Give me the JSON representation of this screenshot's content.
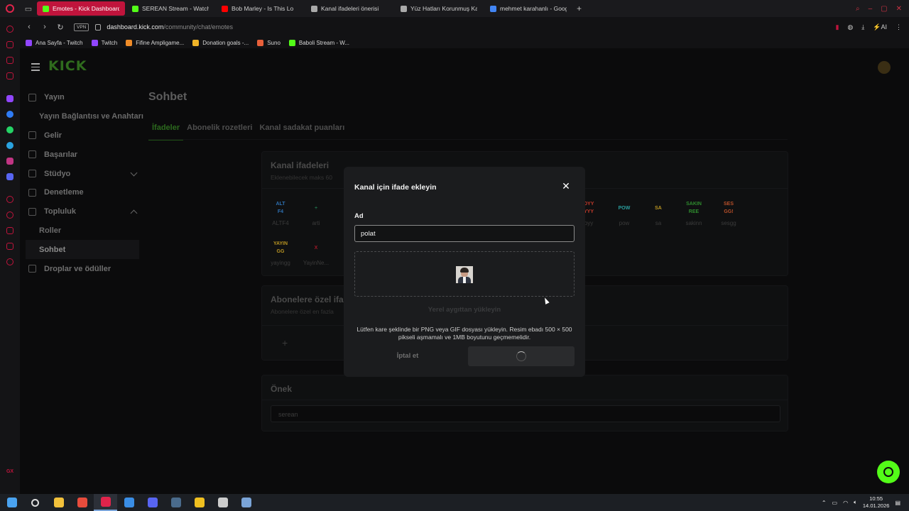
{
  "browser": {
    "tabs": [
      {
        "label": "Emotes - Kick Dashboard",
        "active": true,
        "color": "#53fc18"
      },
      {
        "label": "SEREAN Stream - Watch L",
        "active": false,
        "color": "#53fc18"
      },
      {
        "label": "Bob Marley - Is This Lo",
        "active": false,
        "color": "#ff0000"
      },
      {
        "label": "Kanal ifadeleri önerisi",
        "active": false,
        "color": "#aaaaaa"
      },
      {
        "label": "Yüz Hatları Korunmuş Kar",
        "active": false,
        "color": "#aaaaaa"
      },
      {
        "label": "mehmet karahanlı - Googl",
        "active": false,
        "color": "#4285f4"
      }
    ],
    "url_domain": "dashboard.kick.com",
    "url_path": "/community/chat/emotes",
    "vpn_label": "VPN",
    "ai_label": "AI",
    "bookmarks": [
      {
        "label": "Ana Sayfa - Twitch",
        "color": "#9146ff"
      },
      {
        "label": "Twitch",
        "color": "#9146ff"
      },
      {
        "label": "Fifine Ampligame...",
        "color": "#f08c28"
      },
      {
        "label": "Donation goals -...",
        "color": "#f0b428"
      },
      {
        "label": "Suno",
        "color": "#e8603a"
      },
      {
        "label": "Baboli Stream - W...",
        "color": "#53fc18"
      }
    ]
  },
  "app": {
    "logo": "KICK",
    "nav": [
      {
        "label": "Yayın",
        "type": "item",
        "name": "nav-yayin"
      },
      {
        "label": "Yayın Bağlantısı ve Anahtarı",
        "type": "sub",
        "name": "nav-yayin-baglantisi"
      },
      {
        "label": "Gelir",
        "type": "item",
        "name": "nav-gelir"
      },
      {
        "label": "Başarılar",
        "type": "item",
        "name": "nav-basarilar"
      },
      {
        "label": "Stüdyo",
        "type": "item",
        "name": "nav-studyo"
      },
      {
        "label": "Denetleme",
        "type": "item",
        "name": "nav-denetleme"
      },
      {
        "label": "Topluluk",
        "type": "item",
        "name": "nav-topluluk"
      },
      {
        "label": "Roller",
        "type": "sub",
        "name": "nav-roller"
      },
      {
        "label": "Sohbet",
        "type": "sub",
        "name": "nav-sohbet"
      },
      {
        "label": "Droplar ve ödüller",
        "type": "item",
        "name": "nav-droplar"
      }
    ],
    "page_title": "Sohbet",
    "tabs": [
      "İfadeler",
      "Abonelik rozetleri",
      "Kanal sadakat puanları"
    ],
    "channel_emotes": {
      "title": "Kanal ifadeleri",
      "subtitle": "Eklenebilecek maks 60",
      "emotes": [
        {
          "name": "ALTF4",
          "art": "ALT F4",
          "color": "#2d6fb0"
        },
        {
          "name": "arti",
          "art": "+",
          "color": "#1f6f4a"
        },
        {
          "name": "oyy",
          "art": "OYY YYY",
          "color": "#c03a2b"
        },
        {
          "name": "pow",
          "art": "POW",
          "color": "#2a9e9e"
        },
        {
          "name": "sa",
          "art": "SA",
          "color": "#b89422"
        },
        {
          "name": "sakinn",
          "art": "SAKIN REE",
          "color": "#2e8b2e"
        },
        {
          "name": "sesgg",
          "art": "SES GG!",
          "color": "#b8502a"
        },
        {
          "name": "yayingg",
          "art": "YAYIN GG",
          "color": "#b89422"
        },
        {
          "name": "YayinNe...",
          "art": "X",
          "color": "#a01828"
        }
      ]
    },
    "sub_emotes": {
      "title": "Abonelere özel ifadeler",
      "subtitle": "Abonelere özel en fazla",
      "add": "+"
    },
    "prefix": {
      "title": "Önek",
      "value": "serean"
    }
  },
  "modal": {
    "title": "Kanal için ifade ekleyin",
    "close": "✕",
    "name_label": "Ad",
    "name_value": "polat",
    "upload_link": "Yerel aygıttan yükleyin",
    "help": "Lütfen kare şeklinde bir PNG veya GIF dosyası yükleyin. Resim ebadı 500 × 500 pikseli aşmamalı ve 1MB boyutunu geçmemelidir.",
    "cancel": "İptal et"
  },
  "taskbar": {
    "time": "10:55",
    "date": "14.01.2026",
    "apps": [
      {
        "name": "windows-start",
        "color": "#4aa3f0"
      },
      {
        "name": "search",
        "color": "#dddddd"
      },
      {
        "name": "file-explorer",
        "color": "#f2c13b"
      },
      {
        "name": "chrome",
        "color": "#e74c3c"
      },
      {
        "name": "opera-gx",
        "color": "#e0244b",
        "active": true
      },
      {
        "name": "app-blue",
        "color": "#3a8ee6"
      },
      {
        "name": "discord",
        "color": "#5865f2"
      },
      {
        "name": "steam",
        "color": "#4a6b8c"
      },
      {
        "name": "app-yellow",
        "color": "#f0c020"
      },
      {
        "name": "obs",
        "color": "#cccccc"
      },
      {
        "name": "app-misc",
        "color": "#7aa4d8"
      }
    ]
  }
}
